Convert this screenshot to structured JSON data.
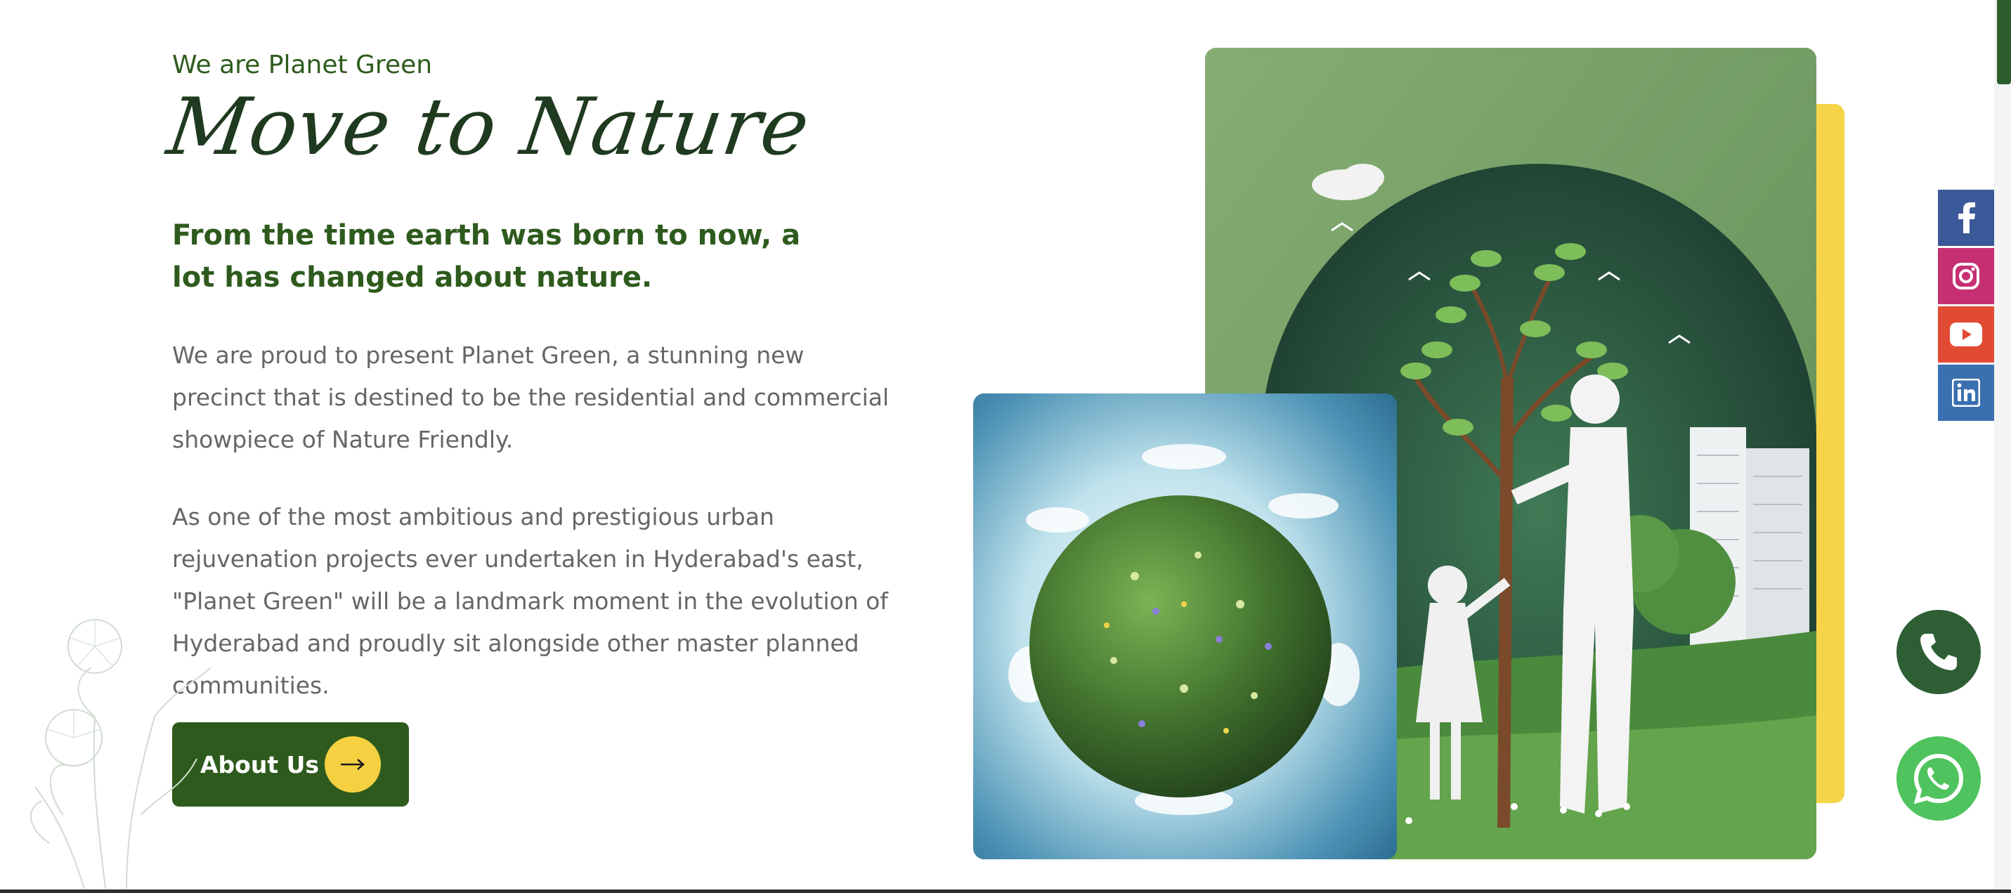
{
  "intro": {
    "eyebrow": "We are Planet Green",
    "script_title": "Move to Nature",
    "lead": "From the time earth was born to now, a lot has changed about nature.",
    "paragraph_1": "We are proud to present Planet Green, a stunning new precinct that is destined to be the residential and commercial showpiece of Nature Friendly.",
    "paragraph_2": "As one of the most ambitious and prestigious urban rejuvenation projects ever undertaken in Hyderabad's east, \"Planet Green\" will be a landmark moment in the evolution of Hyderabad and proudly sit alongside other master planned communities."
  },
  "cta": {
    "about_label": "About Us",
    "arrow_icon": "arrow-right-icon"
  },
  "images": {
    "nature_illustration": "paper-art-family-planting-tree",
    "earth_image": "green-planet-globe"
  },
  "social": [
    {
      "name": "facebook",
      "icon": "facebook-icon",
      "color": "#3b5998"
    },
    {
      "name": "instagram",
      "icon": "instagram-icon",
      "color": "#c72f73"
    },
    {
      "name": "youtube",
      "icon": "youtube-icon",
      "color": "#e24b33"
    },
    {
      "name": "linkedin",
      "icon": "linkedin-icon",
      "color": "#3a6fb0"
    }
  ],
  "floating": {
    "call_icon": "phone-icon",
    "whatsapp_icon": "whatsapp-icon"
  },
  "colors": {
    "brand_green": "#2e5b1d",
    "accent_yellow": "#f5d142"
  }
}
